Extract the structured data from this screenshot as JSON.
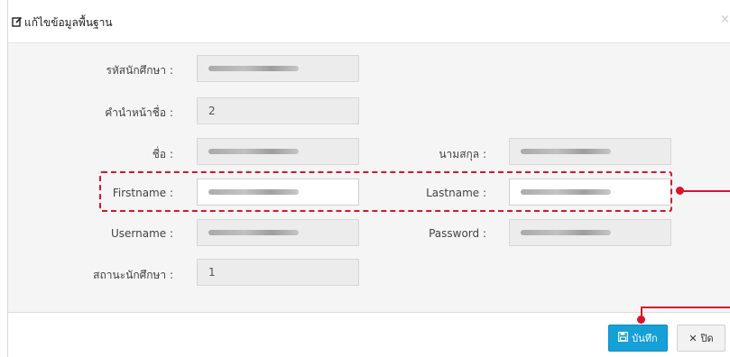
{
  "modal": {
    "title": "แก้ไขข้อมูลพื้นฐาน",
    "close_glyph": "×"
  },
  "form": {
    "student_id": {
      "label": "รหัสนักศึกษา :"
    },
    "prefix": {
      "label": "คำนำหน้าชื่อ :",
      "value": "2"
    },
    "first_name_th": {
      "label": "ชื่อ :"
    },
    "last_name_th": {
      "label": "นามสกุล :"
    },
    "first_name_en": {
      "label": "Firstname :"
    },
    "last_name_en": {
      "label": "Lastname :"
    },
    "username": {
      "label": "Username :"
    },
    "password": {
      "label": "Password :"
    },
    "student_status": {
      "label": "สถานะนักศึกษา :",
      "value": "1"
    }
  },
  "footer": {
    "save_label": "บันทึก",
    "close_label": "ปิด"
  },
  "colors": {
    "accent": "#15a0d8",
    "annotation": "#d9142b"
  }
}
